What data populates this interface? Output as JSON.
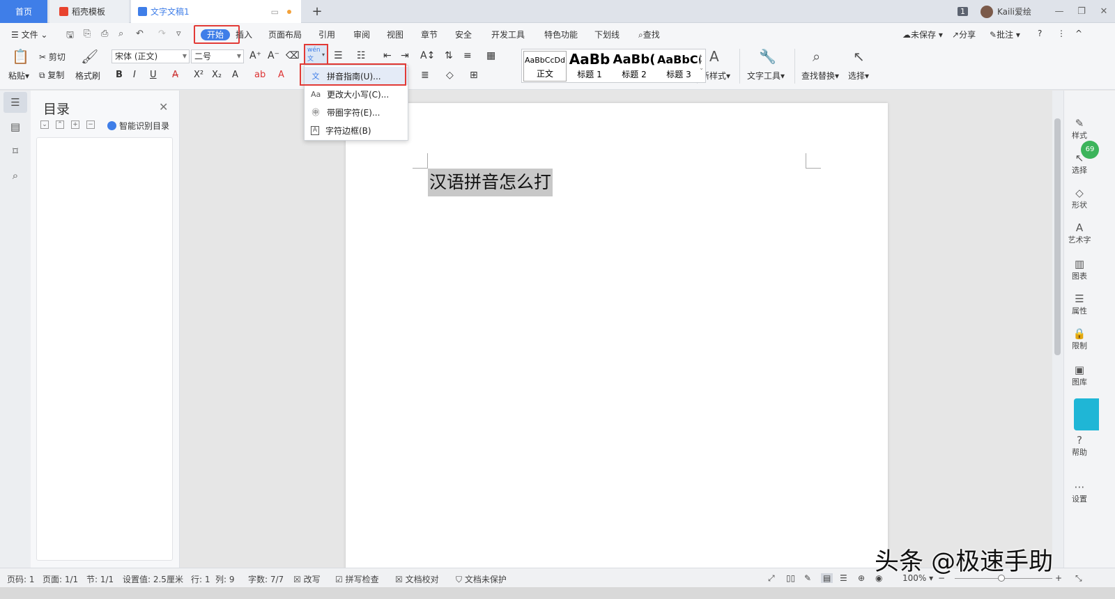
{
  "tabs": {
    "home": "首页",
    "template": "稻壳模板",
    "document": "文字文稿1",
    "plus": "+"
  },
  "window": {
    "page_badge": "1",
    "username": "Kaili爱绘",
    "minimize": "—",
    "restore": "❐",
    "close": "✕"
  },
  "menu": {
    "file": "文件",
    "start": "开始",
    "insert": "插入",
    "page_layout": "页面布局",
    "reference": "引用",
    "review": "审阅",
    "view": "视图",
    "chapter": "章节",
    "security": "安全",
    "developer": "开发工具",
    "features": "特色功能",
    "underline": "下划线",
    "find": "查找",
    "unsaved": "未保存",
    "share": "分享",
    "comment": "批注",
    "help": "?",
    "more": "⋮",
    "collapse": "^"
  },
  "ribbon": {
    "paste": "粘贴",
    "cut": "剪切",
    "copy": "复制",
    "format_painter": "格式刷",
    "font_name": "宋体 (正文)",
    "font_size": "二号",
    "bold": "B",
    "italic": "I",
    "underline": "U",
    "new_style": "新样式",
    "text_tools": "文字工具",
    "find_replace": "查找替换",
    "select": "选择",
    "styles": [
      {
        "preview": "AaBbCcDd",
        "label": "正文"
      },
      {
        "preview": "AaBb",
        "label": "标题 1"
      },
      {
        "preview": "AaBb(",
        "label": "标题 2"
      },
      {
        "preview": "AaBbC(",
        "label": "标题 3"
      }
    ]
  },
  "dropdown": {
    "items": [
      {
        "label": "拼音指南(U)...",
        "icon": "pinyin-icon"
      },
      {
        "label": "更改大小写(C)...",
        "icon": "change-case-icon"
      },
      {
        "label": "带圈字符(E)...",
        "icon": "circled-char-icon"
      },
      {
        "label": "字符边框(B)",
        "icon": "char-border-icon"
      }
    ]
  },
  "toc": {
    "title": "目录",
    "smart": "智能识别目录"
  },
  "document": {
    "text": "汉语拼音怎么打"
  },
  "right_panel": {
    "items": [
      "样式",
      "选择",
      "形状",
      "艺术字",
      "图表",
      "属性",
      "限制",
      "图库",
      "帮助",
      "设置"
    ],
    "badge": "69"
  },
  "status": {
    "page": "页码: 1",
    "pages": "页面: 1/1",
    "section": "节: 1/1",
    "setting": "设置值: 2.5厘米",
    "row": "行: 1",
    "col": "列: 9",
    "words": "字数: 7/7",
    "revise": "改写",
    "spell": "拼写检查",
    "proof": "文档校对",
    "protect": "文档未保护",
    "zoom": "100%"
  },
  "watermark": "头条 @极速手助",
  "colors": {
    "accent": "#3f7ee8",
    "highlight_box": "#e23a36",
    "selection": "#c8c8c8"
  }
}
